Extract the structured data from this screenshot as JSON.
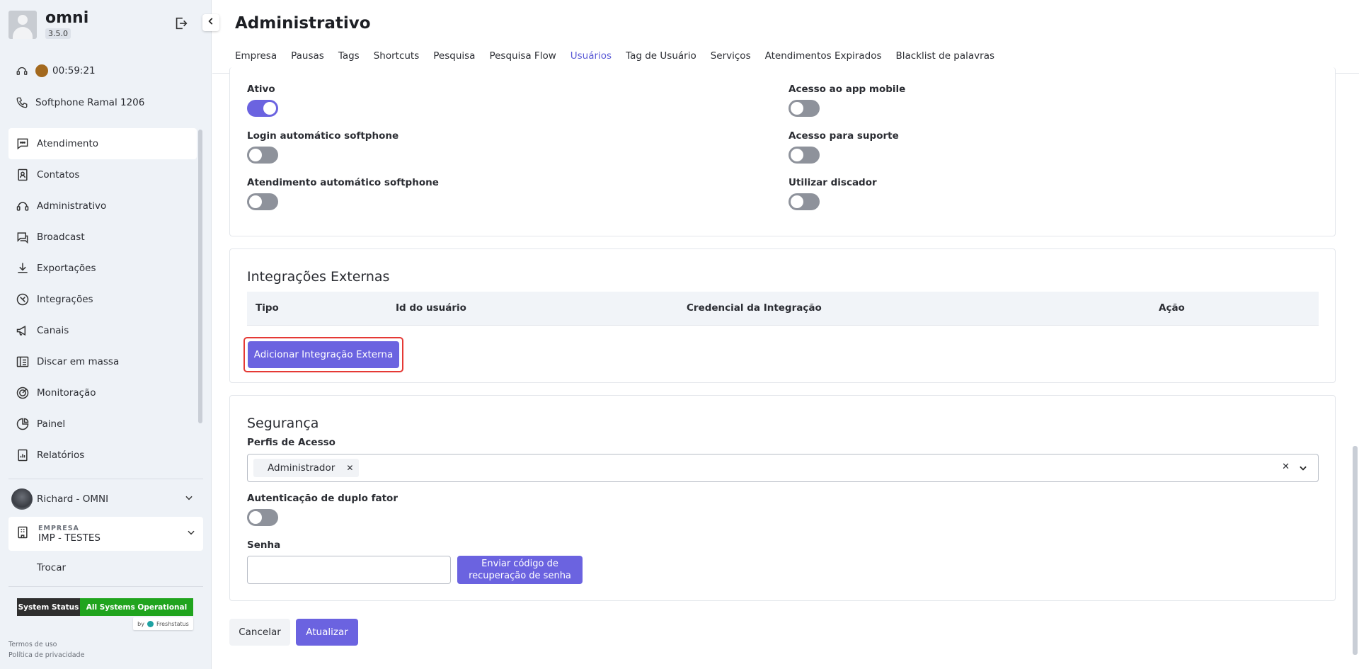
{
  "sidebar": {
    "app_name": "omni",
    "version": "3.5.0",
    "timer": "00:59:21",
    "softphone": "Softphone Ramal 1206",
    "items": [
      {
        "label": "Atendimento",
        "icon": "chat-icon"
      },
      {
        "label": "Contatos",
        "icon": "contacts-icon"
      },
      {
        "label": "Administrativo",
        "icon": "headset-icon"
      },
      {
        "label": "Broadcast",
        "icon": "broadcast-icon"
      },
      {
        "label": "Exportações",
        "icon": "download-icon"
      },
      {
        "label": "Integrações",
        "icon": "integrations-icon"
      },
      {
        "label": "Canais",
        "icon": "megaphone-icon"
      },
      {
        "label": "Discar em massa",
        "icon": "mass-dial-icon"
      },
      {
        "label": "Monitoração",
        "icon": "monitor-icon"
      },
      {
        "label": "Painel",
        "icon": "pie-chart-icon"
      },
      {
        "label": "Relatórios",
        "icon": "reports-icon"
      }
    ],
    "user_name": "Richard - OMNI",
    "company_label": "EMPRESA",
    "company_name": "IMP - TESTES",
    "switch_label": "Trocar",
    "system_status_label": "System Status",
    "system_status_value": "All Systems Operational",
    "by_label": "by",
    "freshstatus": "Freshstatus",
    "terms": "Termos de uso",
    "privacy": "Política de privacidade"
  },
  "header": {
    "title": "Administrativo",
    "tabs": [
      "Empresa",
      "Pausas",
      "Tags",
      "Shortcuts",
      "Pesquisa",
      "Pesquisa Flow",
      "Usuários",
      "Tag de Usuário",
      "Serviços",
      "Atendimentos Expirados",
      "Blacklist de palavras"
    ],
    "active_tab": "Usuários"
  },
  "permissions": {
    "ativo": {
      "label": "Ativo",
      "on": true
    },
    "login_auto": {
      "label": "Login automático softphone",
      "on": false
    },
    "atend_auto": {
      "label": "Atendimento automático softphone",
      "on": false
    },
    "app_mobile": {
      "label": "Acesso ao app mobile",
      "on": false
    },
    "suporte": {
      "label": "Acesso para suporte",
      "on": false
    },
    "discador": {
      "label": "Utilizar discador",
      "on": false
    }
  },
  "integrations": {
    "title": "Integrações Externas",
    "columns": [
      "Tipo",
      "Id do usuário",
      "Credencial da Integração",
      "Ação"
    ],
    "add_button": "Adicionar Integração Externa"
  },
  "security": {
    "title": "Segurança",
    "profiles_label": "Perfis de Acesso",
    "selected_profile": "Administrador",
    "two_factor_label": "Autenticação de duplo fator",
    "two_factor_on": false,
    "password_label": "Senha",
    "password_value": "",
    "send_code_button_line1": "Enviar código de",
    "send_code_button_line2": "recuperação de senha"
  },
  "actions": {
    "cancel": "Cancelar",
    "update": "Atualizar"
  },
  "colors": {
    "accent": "#6b63e0",
    "status_green": "#20a41e",
    "highlight": "#e53935"
  }
}
